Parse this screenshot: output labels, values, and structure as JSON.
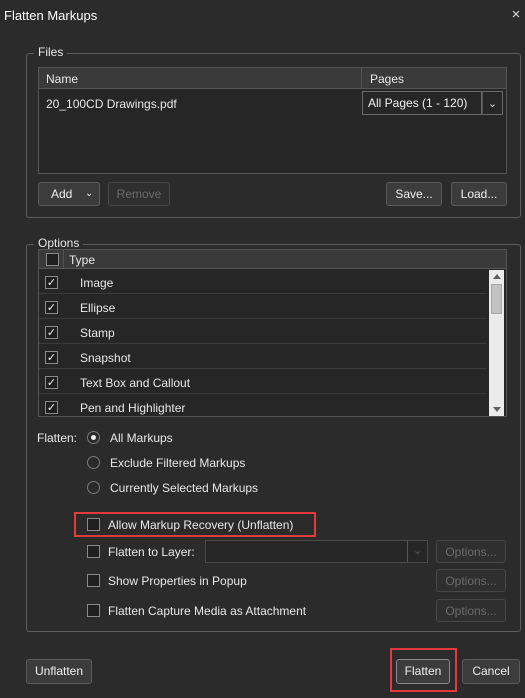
{
  "window": {
    "title": "Flatten Markups",
    "close_glyph": "×"
  },
  "files": {
    "legend": "Files",
    "columns": {
      "name": "Name",
      "pages": "Pages"
    },
    "rows": [
      {
        "name": "20_100CD Drawings.pdf",
        "pages": "All Pages (1 - 120)"
      }
    ],
    "buttons": {
      "add": "Add",
      "remove": "Remove",
      "save": "Save...",
      "load": "Load..."
    }
  },
  "options": {
    "legend": "Options",
    "type_header": "Type",
    "types": [
      {
        "label": "Image",
        "checked": true
      },
      {
        "label": "Ellipse",
        "checked": true
      },
      {
        "label": "Stamp",
        "checked": true
      },
      {
        "label": "Snapshot",
        "checked": true
      },
      {
        "label": "Text Box and Callout",
        "checked": true
      },
      {
        "label": "Pen and Highlighter",
        "checked": true
      }
    ],
    "flatten_label": "Flatten:",
    "flatten_choices": [
      {
        "label": "All Markups",
        "selected": true
      },
      {
        "label": "Exclude Filtered Markups",
        "selected": false
      },
      {
        "label": "Currently Selected Markups",
        "selected": false
      }
    ],
    "allow_recovery": "Allow Markup Recovery (Unflatten)",
    "flatten_to_layer": "Flatten to Layer:",
    "layer_value": "",
    "show_properties": "Show Properties in Popup",
    "capture_media": "Flatten Capture Media as Attachment",
    "options_button": "Options..."
  },
  "footer": {
    "unflatten": "Unflatten",
    "flatten": "Flatten",
    "cancel": "Cancel"
  },
  "colors": {
    "dialog_bg": "#2b2b2b",
    "highlight": "#e23b3b"
  }
}
